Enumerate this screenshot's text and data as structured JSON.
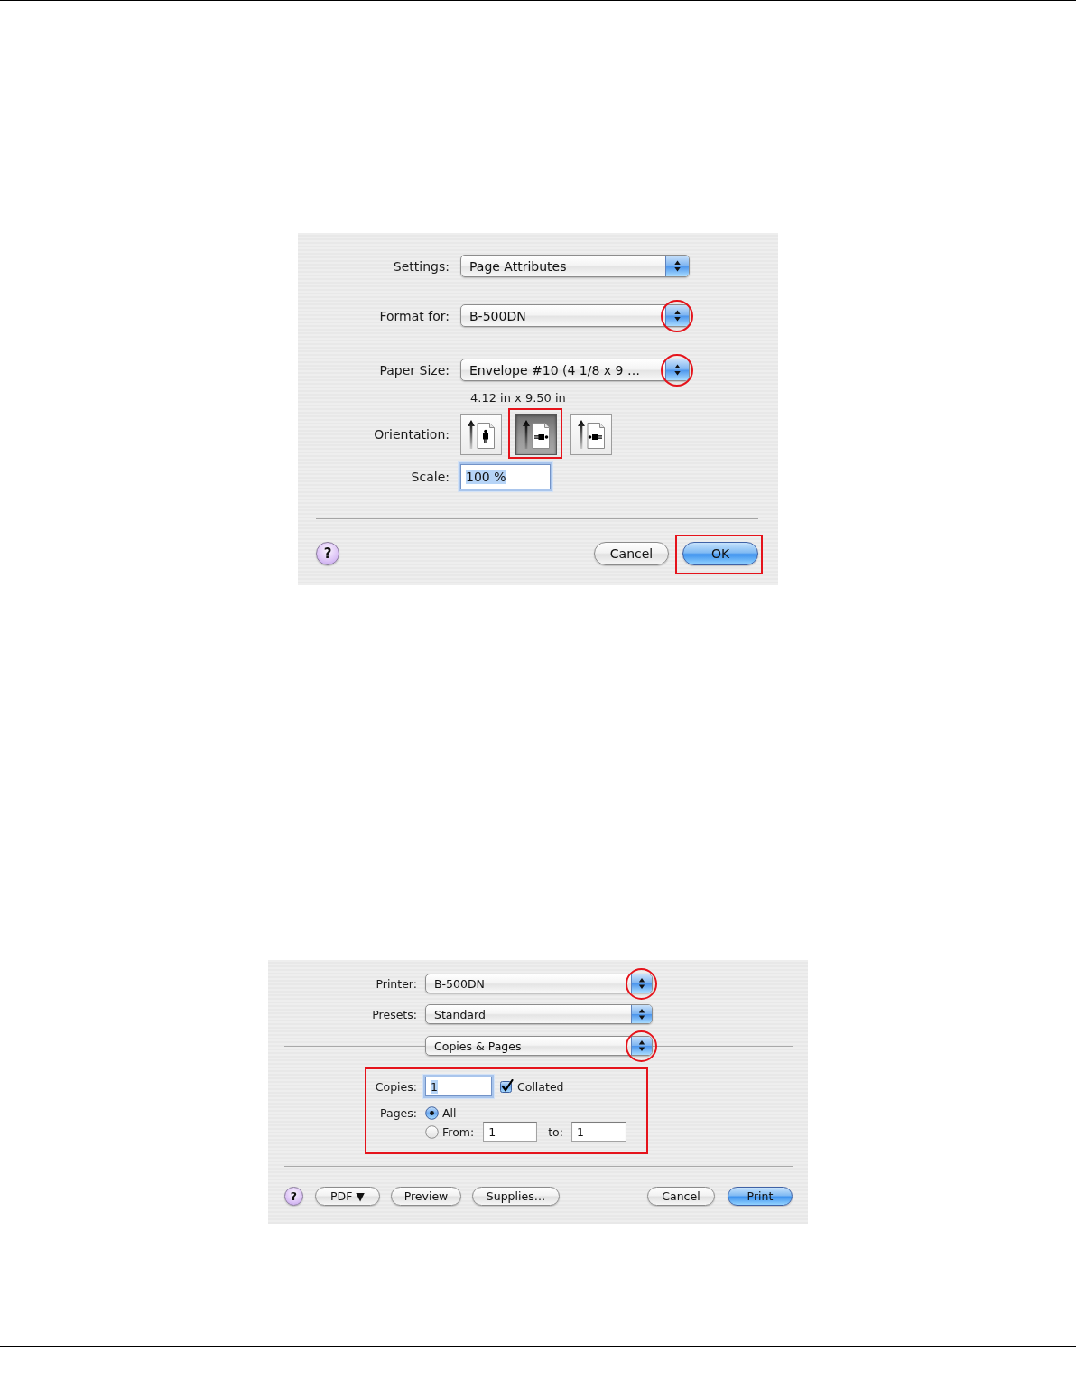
{
  "page_setup": {
    "fields": [
      {
        "label": "Settings:",
        "value": "Page Attributes",
        "highlighted": false
      },
      {
        "label": "Format for:",
        "value": "B-500DN",
        "highlighted": true
      },
      {
        "label": "Paper Size:",
        "value": "Envelope #10 (4 1/8 x 9 …",
        "highlighted": true,
        "note": "4.12 in x 9.50 in"
      }
    ],
    "orientation": {
      "label": "Orientation:",
      "options": [
        {
          "kind": "portrait",
          "selected": false,
          "highlighted": false
        },
        {
          "kind": "landscape",
          "selected": true,
          "highlighted": true
        },
        {
          "kind": "reverse_landscape",
          "selected": false,
          "highlighted": false
        }
      ]
    },
    "scale": {
      "label": "Scale:",
      "value": "100 %",
      "focused": true
    },
    "help_button": {
      "label": "?"
    },
    "buttons": [
      {
        "label": "Cancel",
        "kind": "normal",
        "highlighted": false
      },
      {
        "label": "OK",
        "kind": "default",
        "highlighted": true
      }
    ]
  },
  "print_dialog": {
    "popups": [
      {
        "label": "Printer:",
        "value": "B-500DN",
        "highlighted": true
      },
      {
        "label": "Presets:",
        "value": "Standard",
        "highlighted": false
      }
    ],
    "panel_popup": {
      "value": "Copies & Pages",
      "highlighted": true
    },
    "copies_pages": {
      "highlighted": true,
      "copies": {
        "label": "Copies:",
        "value": "1",
        "focused": true
      },
      "collated": {
        "label": "Collated",
        "checked": true
      },
      "pages_label": "Pages:",
      "page_options": [
        {
          "kind": "all",
          "label": "All",
          "selected": true
        },
        {
          "kind": "range",
          "label": "From:",
          "selected": false,
          "from": {
            "value": "1",
            "focused": false
          },
          "to_label": "to:",
          "to": {
            "value": "1",
            "focused": false
          }
        }
      ]
    },
    "help_button": {
      "label": "?"
    },
    "left_buttons": [
      {
        "label": "PDF ▼",
        "kind": "normal"
      },
      {
        "label": "Preview",
        "kind": "normal"
      },
      {
        "label": "Supplies…",
        "kind": "normal"
      }
    ],
    "right_buttons": [
      {
        "label": "Cancel",
        "kind": "normal"
      },
      {
        "label": "Print",
        "kind": "default"
      }
    ]
  }
}
